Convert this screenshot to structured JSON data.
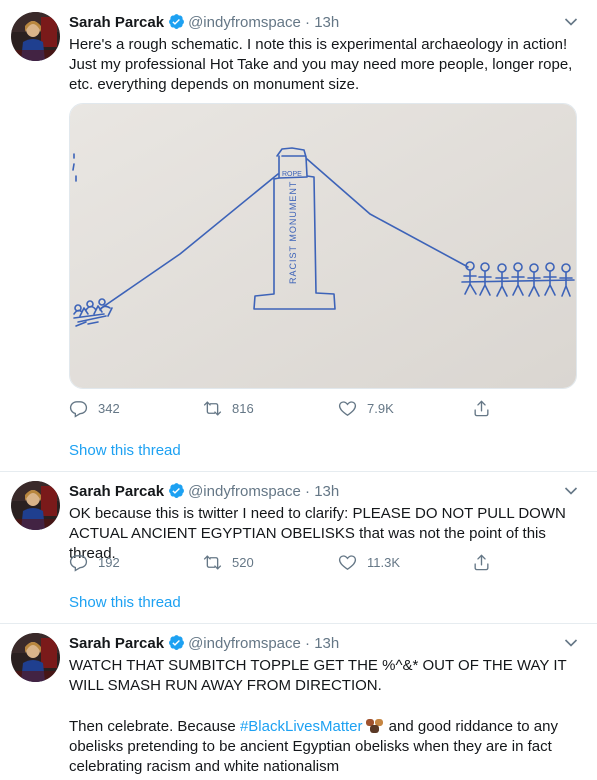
{
  "tweets": [
    {
      "name": "Sarah Parcak",
      "handle": "@indyfromspace",
      "sep": "·",
      "time": "13h",
      "text": "Here's a rough schematic. I note this is experimental archaeology in action! Just my professional Hot Take and you may need more people, longer rope, etc. everything depends on monument size.",
      "media_labels": {
        "top": "ROPE",
        "side": "RACIST MONUMENT"
      },
      "replies": "342",
      "retweets": "816",
      "likes": "7.9K",
      "show_thread": "Show this thread"
    },
    {
      "name": "Sarah Parcak",
      "handle": "@indyfromspace",
      "sep": "·",
      "time": "13h",
      "text": "OK because this is twitter I need to clarify: PLEASE DO NOT PULL DOWN ACTUAL ANCIENT EGYPTIAN OBELISKS that was not the point of this thread.",
      "replies": "192",
      "retweets": "520",
      "likes": "11.3K",
      "show_thread": "Show this thread"
    },
    {
      "name": "Sarah Parcak",
      "handle": "@indyfromspace",
      "sep": "·",
      "time": "13h",
      "text_1": "WATCH THAT SUMBITCH TOPPLE GET THE %^&* OUT OF THE WAY IT WILL SMASH RUN AWAY  FROM DIRECTION.",
      "text_2_pre": "Then celebrate. Because ",
      "hashtag": "#BlackLivesMatter",
      "text_2_post": " and good riddance to any obelisks pretending to be ancient Egyptian obelisks when they are in fact celebrating racism and white nationalism"
    }
  ],
  "colors": {
    "accent": "#1da1f2",
    "muted": "#657786",
    "divider": "#e6ecf0",
    "sketch": "#3d63b8"
  },
  "icons": [
    "verified-badge-icon",
    "chevron-down-icon",
    "reply-icon",
    "retweet-icon",
    "like-icon",
    "share-icon",
    "fist-emoji-icon"
  ]
}
